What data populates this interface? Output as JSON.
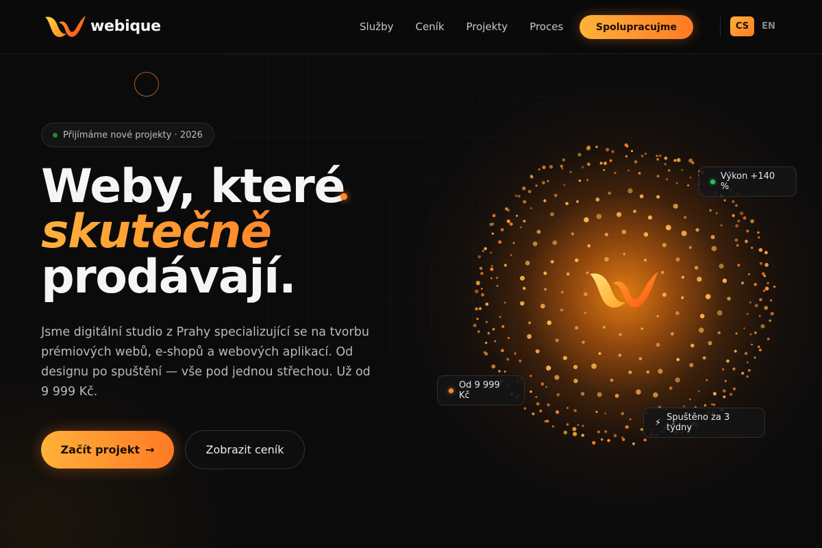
{
  "brand": {
    "name": "webique",
    "logo_icon": "w-logo-icon"
  },
  "nav": {
    "items": [
      {
        "label": "Služby"
      },
      {
        "label": "Ceník"
      },
      {
        "label": "Projekty"
      },
      {
        "label": "Proces"
      }
    ],
    "cta_label": "Spolupracujme"
  },
  "lang": {
    "active": "CS",
    "other": "EN"
  },
  "hero": {
    "badge": "Přijímáme nové projekty · 2026",
    "headline_line1": "Weby, které",
    "headline_line2": "skutečně",
    "headline_line3": "prodávají.",
    "lead": "Jsme digitální studio z Prahy specializující se na tvorbu prémiových webů, e-shopů a webových aplikací. Od designu po spuštění — vše pod jednou střechou. Už od 9 999 Kč.",
    "primary_label": "Začít projekt",
    "primary_arrow": "→",
    "secondary_label": "Zobrazit ceník"
  },
  "stats": {
    "performance": "Výkon +140 %",
    "price": "Od 9 999 Kč",
    "launch_icon": "⚡",
    "launch": "Spuštěno za 3 týdny"
  },
  "colors": {
    "accent_start": "#ffb13a",
    "accent_end": "#ff7a24",
    "background": "#0b0b0c",
    "status_green": "#22c55e"
  }
}
